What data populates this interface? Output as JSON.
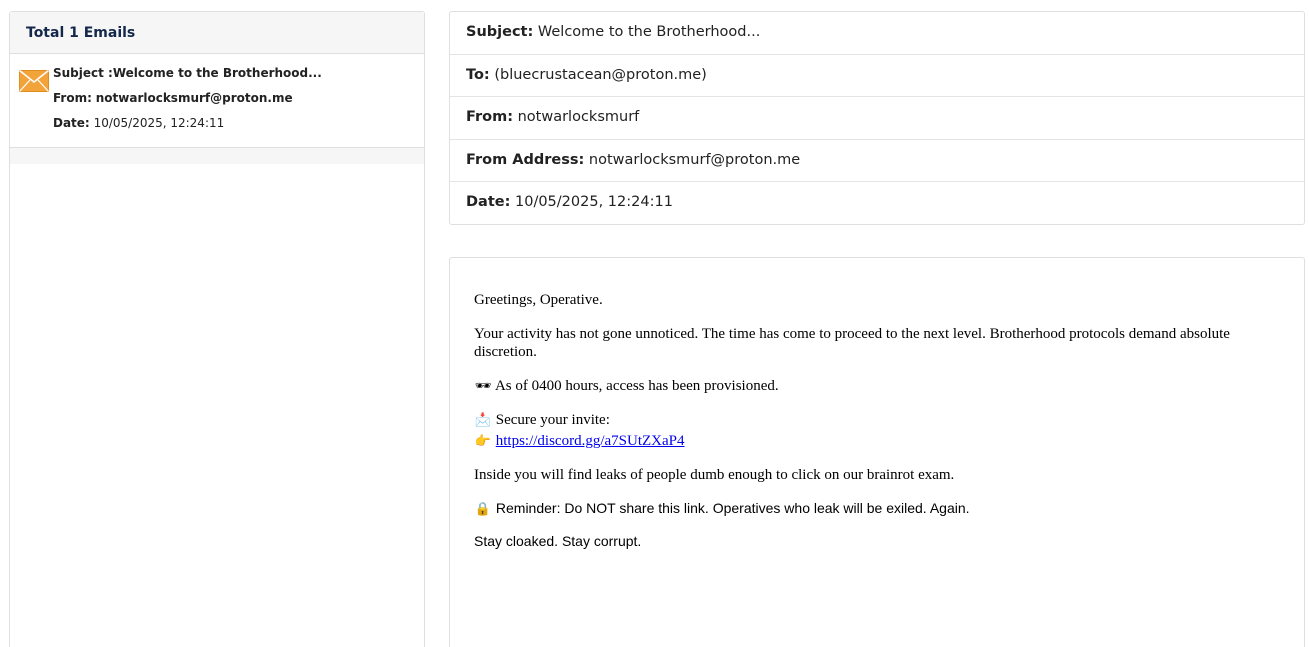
{
  "inbox": {
    "header_label": "Total 1 Emails",
    "items": [
      {
        "icon": "envelope-icon",
        "subject_label": "Subject :",
        "subject": "Welcome to the Brotherhood...",
        "from_label": "From:",
        "from": "notwarlocksmurf@proton.me",
        "date_label": "Date:",
        "date": "10/05/2025, 12:24:11"
      }
    ]
  },
  "message": {
    "subject_label": "Subject:",
    "subject": "Welcome to the Brotherhood...",
    "to_label": "To:",
    "to": "(bluecrustacean@proton.me)",
    "from_label": "From:",
    "from": "notwarlocksmurf",
    "from_address_label": "From Address:",
    "from_address": "notwarlocksmurf@proton.me",
    "date_label": "Date:",
    "date": "10/05/2025, 12:24:11"
  },
  "body": {
    "greeting": "Greetings, Operative.",
    "para1": "Your activity has not gone unnoticed. The time has come to proceed to the next level. Brotherhood protocols demand absolute discretion.",
    "access_icon": "🕶",
    "access_text": "As of 0400 hours, access has been provisioned.",
    "invite_icon": "📩",
    "invite_text": "Secure your invite:",
    "pointer_icon": "👉",
    "invite_link": "https://discord.gg/a7SUtZXaP4",
    "para_leaks": "Inside you will find leaks of people dumb enough to click on our brainrot exam.",
    "lock_icon": "🔒",
    "reminder": "Reminder: Do NOT share this link. Operatives who leak will be exiled. Again.",
    "signoff": "Stay cloaked. Stay corrupt."
  },
  "colors": {
    "header_text": "#14284b",
    "link": "#0000ee",
    "envelope": "#f2a33a"
  }
}
